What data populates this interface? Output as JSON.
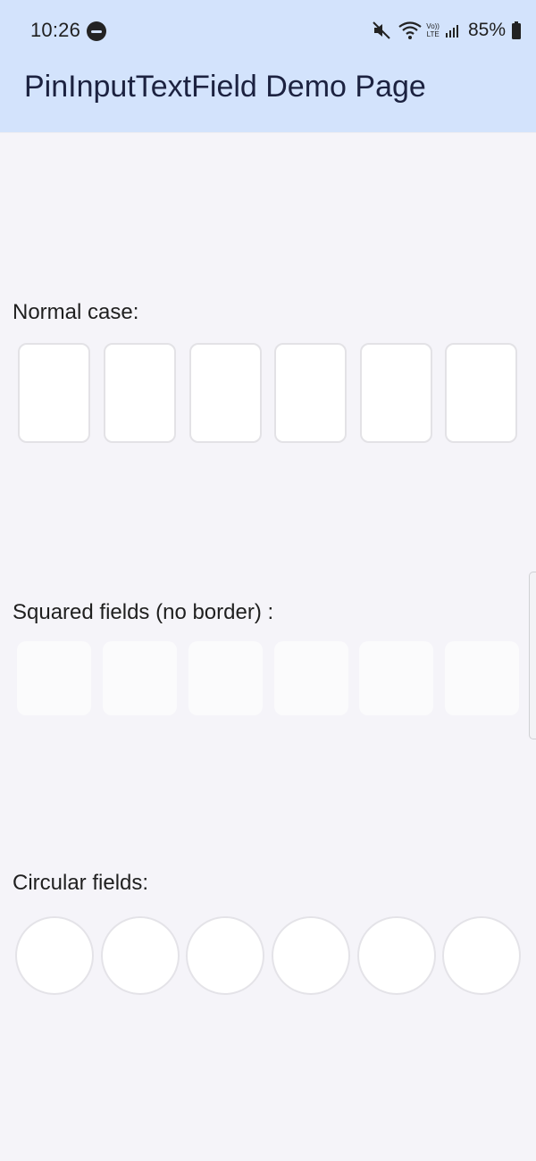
{
  "status_bar": {
    "time": "10:26",
    "battery": "85%",
    "network_label": "LTE",
    "volte_label": "Vo))"
  },
  "app_bar": {
    "title": "PinInputTextField Demo Page"
  },
  "sections": {
    "normal": {
      "label": "Normal case:"
    },
    "squared": {
      "label": "Squared fields (no border) :"
    },
    "circular": {
      "label": "Circular fields:"
    }
  },
  "colors": {
    "app_bar": "#d3e3fc",
    "background": "#f5f4f9",
    "field": "#ffffff"
  }
}
